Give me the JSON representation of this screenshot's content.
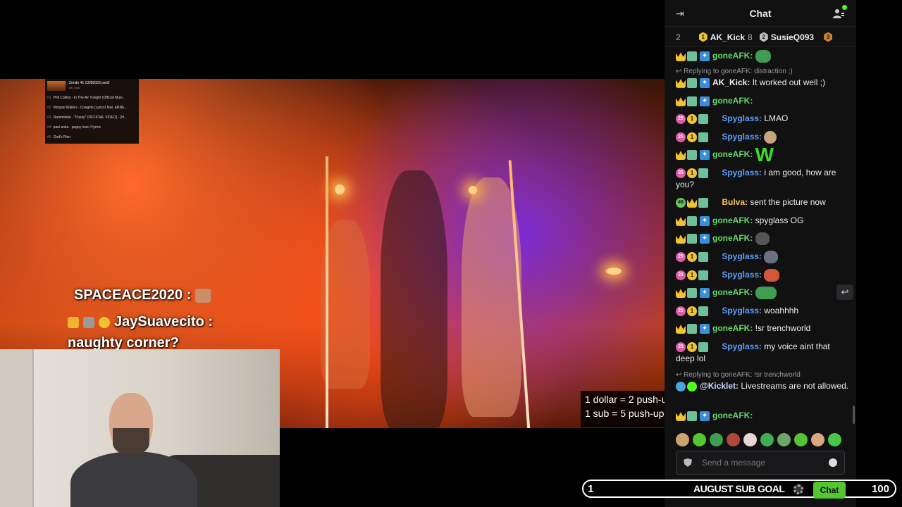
{
  "stream": {
    "overlay_chat": {
      "sp_name": "SPACEACE2020 :",
      "jay_name": "JaySuavecito :",
      "jay_msg": "naughty corner?"
    },
    "push_info": {
      "line1": "1 dollar = 2 push-u",
      "line2": "1 sub = 5 push-up"
    },
    "playlist": {
      "title": "Zondo 41 10282023 part2",
      "subtitle": "AK_Kick",
      "items": [
        {
          "n": "#1",
          "text": "Phil Collins - In The Air Tonight (Official Musi..."
        },
        {
          "n": "#2",
          "text": "Morgan Wallen - Cowgirls (Lyrics) feat. ERNE..."
        },
        {
          "n": "#3",
          "text": "Rammstein - \"Pussy\" (OFFICIAL VIDEO) - [H..."
        },
        {
          "n": "#4",
          "text": "paul anka - puppy love // lyrics"
        },
        {
          "n": "#5",
          "text": "God's Plan"
        }
      ]
    }
  },
  "chat": {
    "title": "Chat",
    "leaderboard": [
      {
        "rank": "",
        "name": "",
        "count": "2"
      },
      {
        "rank": "1",
        "name": "AK_Kick",
        "count": "8"
      },
      {
        "rank": "2",
        "name": "SusieQ093",
        "count": ""
      },
      {
        "rank": "3",
        "name": "",
        "count": ""
      }
    ],
    "messages": {
      "m1": {
        "user": "goneAFK:",
        "text": ""
      },
      "r1": "Replying to goneAFK: distraction ;)",
      "m2": {
        "user": "AK_Kick:",
        "text": " It worked out well ;)"
      },
      "m3": {
        "user": "goneAFK:",
        "text": ""
      },
      "m4": {
        "user": "Spyglass:",
        "text": " LMAO",
        "badge": "25"
      },
      "m5": {
        "user": "Spyglass:",
        "text": "",
        "badge": "25"
      },
      "m6": {
        "user": "goneAFK:",
        "text": "",
        "emote": "W"
      },
      "m7": {
        "user": "Spyglass:",
        "text": " i am good, how are you?",
        "badge": "25"
      },
      "m8": {
        "user": "Bulva:",
        "text": " sent the picture now",
        "badge": "49"
      },
      "m9": {
        "user": "goneAFK:",
        "text": " spyglass OG"
      },
      "m10": {
        "user": "goneAFK:",
        "text": ""
      },
      "m11": {
        "user": "Spyglass:",
        "text": "",
        "badge": "25"
      },
      "m12": {
        "user": "Spyglass:",
        "text": "",
        "badge": "25"
      },
      "m13": {
        "user": "goneAFK:",
        "text": ""
      },
      "m14": {
        "user": "Spyglass:",
        "text": " woahhhh",
        "badge": "25"
      },
      "m15": {
        "user": "goneAFK:",
        "text": " !sr trenchworld"
      },
      "m16": {
        "user": "Spyglass:",
        "text": " my voice aint that deep lol",
        "badge": "25"
      },
      "r2": "Replying to goneAFK: !sr trenchworld",
      "m17": {
        "user": "@Kicklet:",
        "text": " Livestreams are not allowed."
      },
      "m18": {
        "user": "goneAFK:",
        "text": ""
      }
    },
    "composer": {
      "placeholder": "Send a message"
    }
  },
  "subgoal": {
    "current": "1",
    "label": "AUGUST SUB GOAL",
    "target": "100",
    "chat_button": "Chat"
  },
  "colors": {
    "kick_green": "#53fc18",
    "gone_afk": "#65d86a",
    "spyglass": "#5f9ef7"
  }
}
